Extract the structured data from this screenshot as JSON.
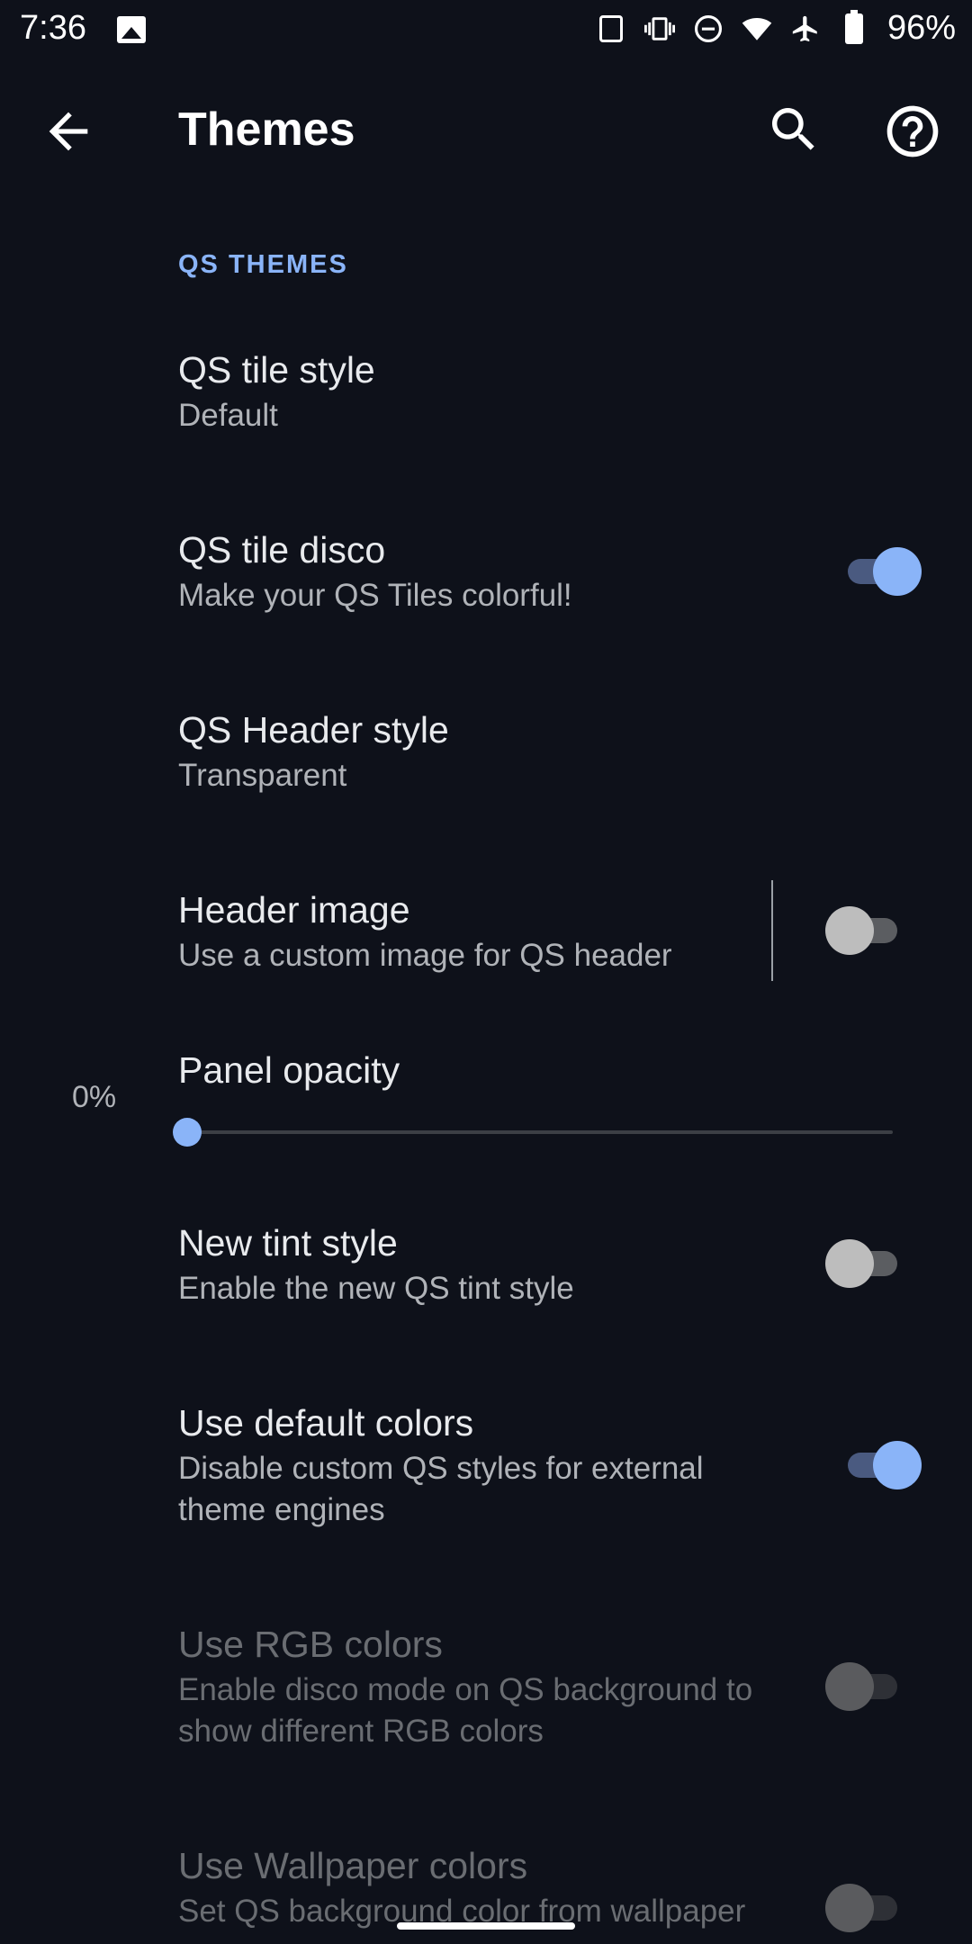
{
  "status_bar": {
    "time": "7:36",
    "battery": "96%",
    "icons": [
      "image-icon",
      "nfc-icon",
      "vibrate-icon",
      "do-not-disturb-icon",
      "wifi-icon",
      "airplane-icon",
      "battery-icon"
    ]
  },
  "app_bar": {
    "title": "Themes",
    "back_icon": "arrow-back-icon",
    "search_icon": "search-icon",
    "help_icon": "help-icon"
  },
  "section": {
    "header": "QS THEMES"
  },
  "preferences": [
    {
      "title": "QS tile style",
      "summary": "Default"
    },
    {
      "title": "QS tile disco",
      "summary": "Make your QS Tiles colorful!",
      "switch": true
    },
    {
      "title": "QS Header style",
      "summary": "Transparent"
    },
    {
      "title": "Header image",
      "summary": "Use a custom image for QS header",
      "switch": false
    },
    {
      "title": "Panel opacity",
      "value_label": "0%",
      "value": 0
    },
    {
      "title": "New tint style",
      "summary": "Enable the new QS tint style",
      "switch": false
    },
    {
      "title": "Use default colors",
      "summary": "Disable custom QS styles for external theme engines",
      "switch": true
    },
    {
      "title": "Use RGB colors",
      "summary": "Enable disco mode on QS background to show different RGB colors",
      "switch": false,
      "enabled": false
    },
    {
      "title": "Use Wallpaper colors",
      "summary": "Set QS background color from wallpaper",
      "switch": false,
      "enabled": false
    }
  ],
  "colors": {
    "accent": "#8ab4f8",
    "background": "#0e111a"
  }
}
